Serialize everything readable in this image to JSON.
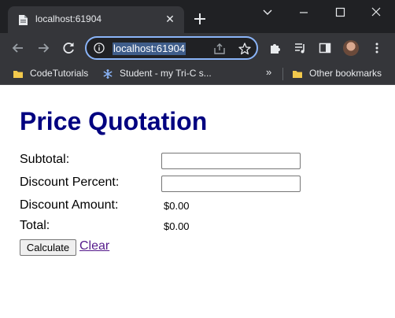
{
  "browser": {
    "tab": {
      "title": "localhost:61904",
      "close_glyph": "✕",
      "favicon": "page-icon"
    },
    "new_tab_icon": "plus-icon",
    "window_controls": [
      "chevron-down-icon",
      "minimize-icon",
      "maximize-icon",
      "close-icon"
    ],
    "toolbar": {
      "back_icon": "arrow-left-icon",
      "forward_icon": "arrow-right-icon",
      "reload_icon": "reload-icon",
      "address": "localhost:61904",
      "address_icons": [
        "info-icon",
        "share-icon",
        "star-icon"
      ],
      "right_icons": [
        "extensions-icon",
        "media-icon",
        "side-panel-icon",
        "avatar",
        "menu-icon"
      ]
    },
    "bookmarks": {
      "items": [
        {
          "label": "CodeTutorials",
          "icon": "folder-icon"
        },
        {
          "label": "Student - my Tri-C s...",
          "icon": "snowflake-icon"
        }
      ],
      "more": "»",
      "other": {
        "label": "Other bookmarks",
        "icon": "folder-icon"
      }
    },
    "colors": {
      "chrome_dark": "#202124",
      "chrome_mid": "#35363a",
      "focus_ring": "#8ab4f8",
      "folder": "#f2c94c"
    }
  },
  "page": {
    "heading": "Price Quotation",
    "heading_color": "#000080",
    "rows": [
      {
        "label": "Subtotal:",
        "type": "input",
        "value": ""
      },
      {
        "label": "Discount Percent:",
        "type": "input",
        "value": ""
      },
      {
        "label": "Discount Amount:",
        "type": "text",
        "value": "$0.00"
      },
      {
        "label": "Total:",
        "type": "text",
        "value": "$0.00"
      }
    ],
    "calculate_label": "Calculate",
    "clear_label": "Clear",
    "link_color": "#551a8b"
  }
}
